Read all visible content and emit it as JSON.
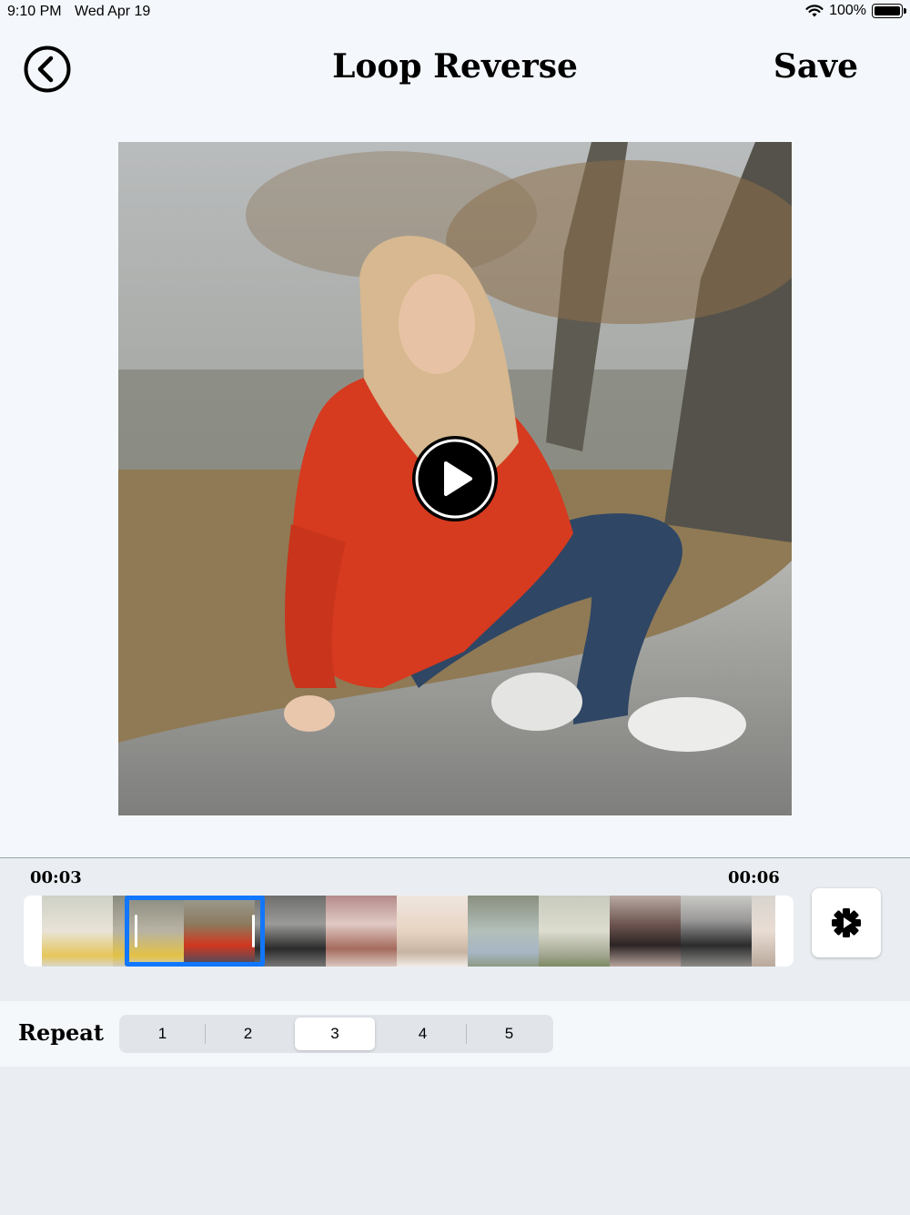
{
  "status_bar": {
    "time": "9:10 PM",
    "date": "Wed Apr 19",
    "battery": "100%"
  },
  "header": {
    "title": "Loop Reverse",
    "save_label": "Save",
    "back_icon": "back-arrow-circle-icon"
  },
  "preview": {
    "play_icon": "play-icon"
  },
  "timeline": {
    "start_time": "00:03",
    "end_time": "00:06",
    "settings_icon": "gear-icon"
  },
  "repeat": {
    "label": "Repeat",
    "options": [
      "1",
      "2",
      "3",
      "4",
      "5"
    ],
    "selected": "3"
  },
  "colors": {
    "accent": "#1177ff",
    "background": "#f4f8fc",
    "panel": "#eaeef2"
  }
}
